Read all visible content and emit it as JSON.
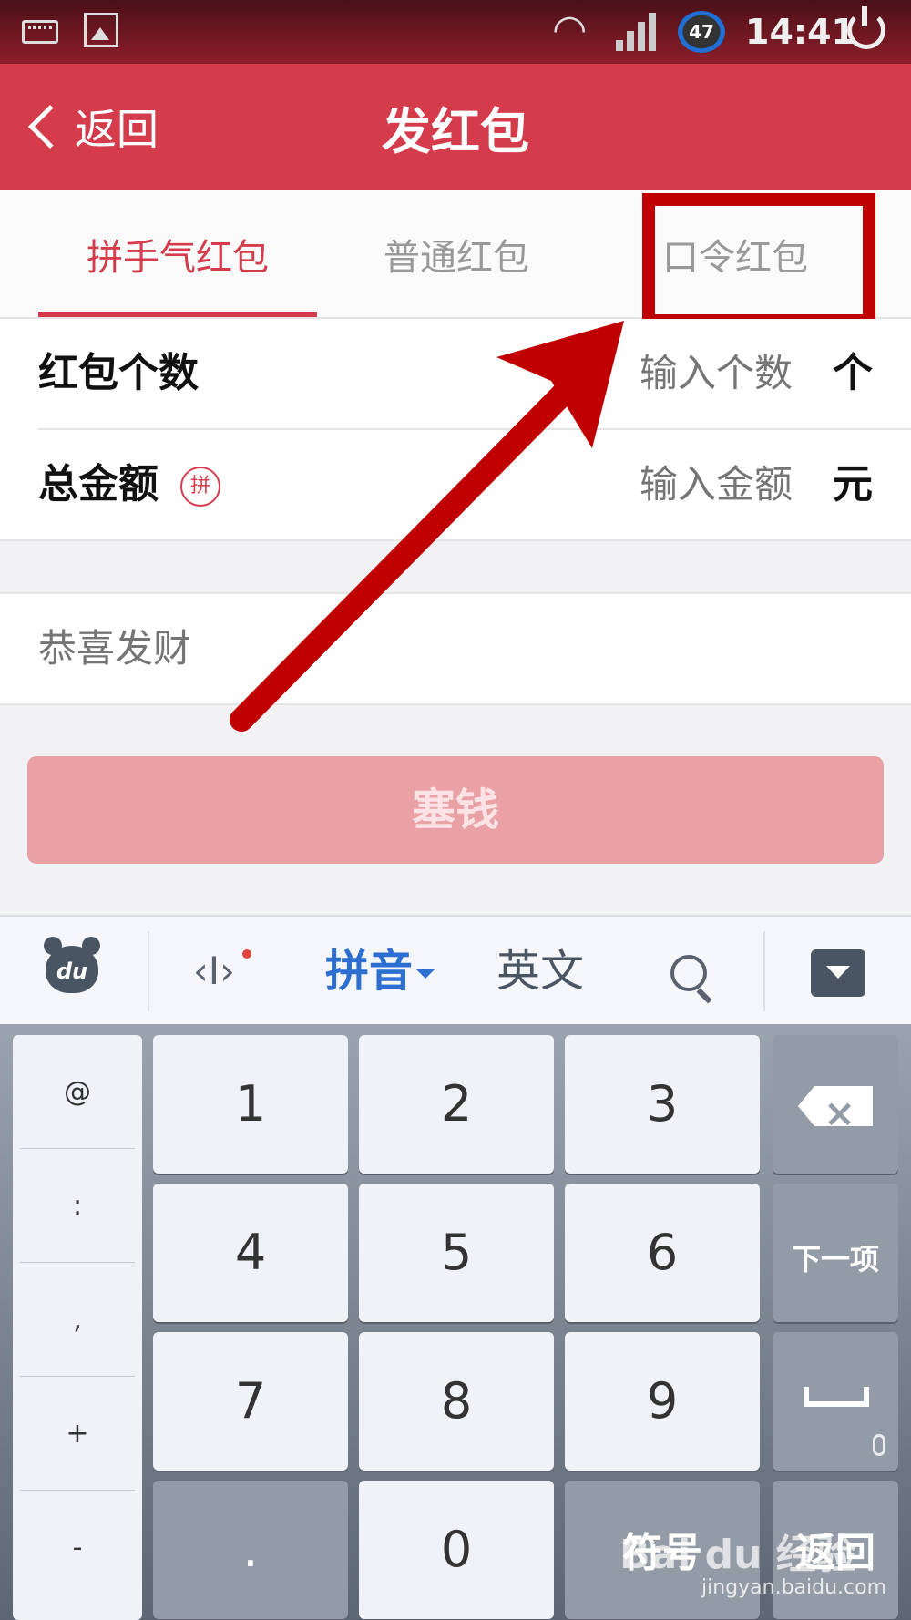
{
  "status_bar": {
    "time": "14:41",
    "battery_level": "47"
  },
  "header": {
    "back_label": "返回",
    "title": "发红包"
  },
  "tabs": [
    {
      "label": "拼手气红包",
      "active": true
    },
    {
      "label": "普通红包",
      "active": false
    },
    {
      "label": "口令红包",
      "active": false
    }
  ],
  "form": {
    "count": {
      "label": "红包个数",
      "placeholder": "输入个数",
      "unit": "个"
    },
    "amount": {
      "label": "总金额",
      "badge": "拼",
      "placeholder": "输入金额",
      "unit": "元"
    },
    "message_placeholder": "恭喜发财"
  },
  "submit_label": "塞钱",
  "keyboard": {
    "toolbar": {
      "pinyin": "拼音",
      "english": "英文"
    },
    "side_keys": [
      "@",
      ":",
      ",",
      "+",
      "-"
    ],
    "digits": [
      "1",
      "2",
      "3",
      "4",
      "5",
      "6",
      "7",
      "8",
      "9",
      "0"
    ],
    "dot": ".",
    "next_label": "下一项",
    "symbols_label": "符号",
    "back_label": "返回"
  },
  "watermark": {
    "brand": "Bai du 经验",
    "url": "jingyan.baidu.com"
  },
  "colors": {
    "accent": "#d43c4c",
    "highlight": "#c00000",
    "button_disabled": "#e9a1a6"
  }
}
